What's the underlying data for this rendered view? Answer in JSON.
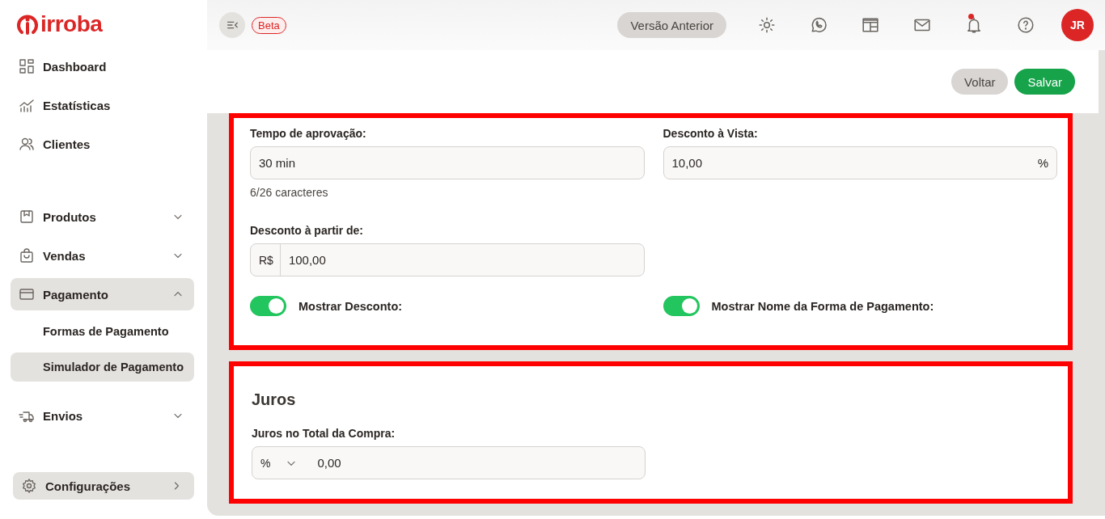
{
  "logo": {
    "text": "irroba"
  },
  "sidebar": {
    "sections": [
      {
        "items": [
          {
            "label": "Dashboard",
            "selected": false
          },
          {
            "label": "Estatísticas",
            "selected": false
          },
          {
            "label": "Clientes",
            "selected": false
          }
        ]
      },
      {
        "items": [
          {
            "label": "Produtos",
            "selected": false,
            "expanded": false
          },
          {
            "label": "Vendas",
            "selected": false,
            "expanded": false
          },
          {
            "label": "Pagamento",
            "selected": true,
            "expanded": true,
            "children": [
              {
                "label": "Formas de Pagamento",
                "selected": false
              },
              {
                "label": "Simulador de Pagamento",
                "selected": true
              }
            ]
          },
          {
            "label": "Envios",
            "selected": false,
            "expanded": false
          }
        ]
      }
    ],
    "footer": {
      "label": "Configurações"
    }
  },
  "header": {
    "beta_badge": "Beta",
    "previous_version_button": "Versão Anterior",
    "notification_unread": true,
    "avatar": "JR"
  },
  "actions": {
    "back": "Voltar",
    "save": "Salvar"
  },
  "discount_card": {
    "highlighted": true,
    "approval_time": {
      "label": "Tempo de aprovação:",
      "value": "30 min",
      "counter": "6/26 caracteres"
    },
    "cash_discount": {
      "label": "Desconto à Vista:",
      "value": "10,00",
      "suffix": "%"
    },
    "discount_from": {
      "label": "Desconto à partir de:",
      "prefix": "R$",
      "value": "100,00"
    },
    "toggles": [
      {
        "label": "Mostrar Desconto:",
        "on": true
      },
      {
        "label": "Mostrar Nome da Forma de Pagamento:",
        "on": true
      }
    ]
  },
  "interest_card": {
    "highlighted": true,
    "title": "Juros",
    "label": "Juros no Total da Compra:",
    "unit": "%",
    "value": "0,00"
  }
}
